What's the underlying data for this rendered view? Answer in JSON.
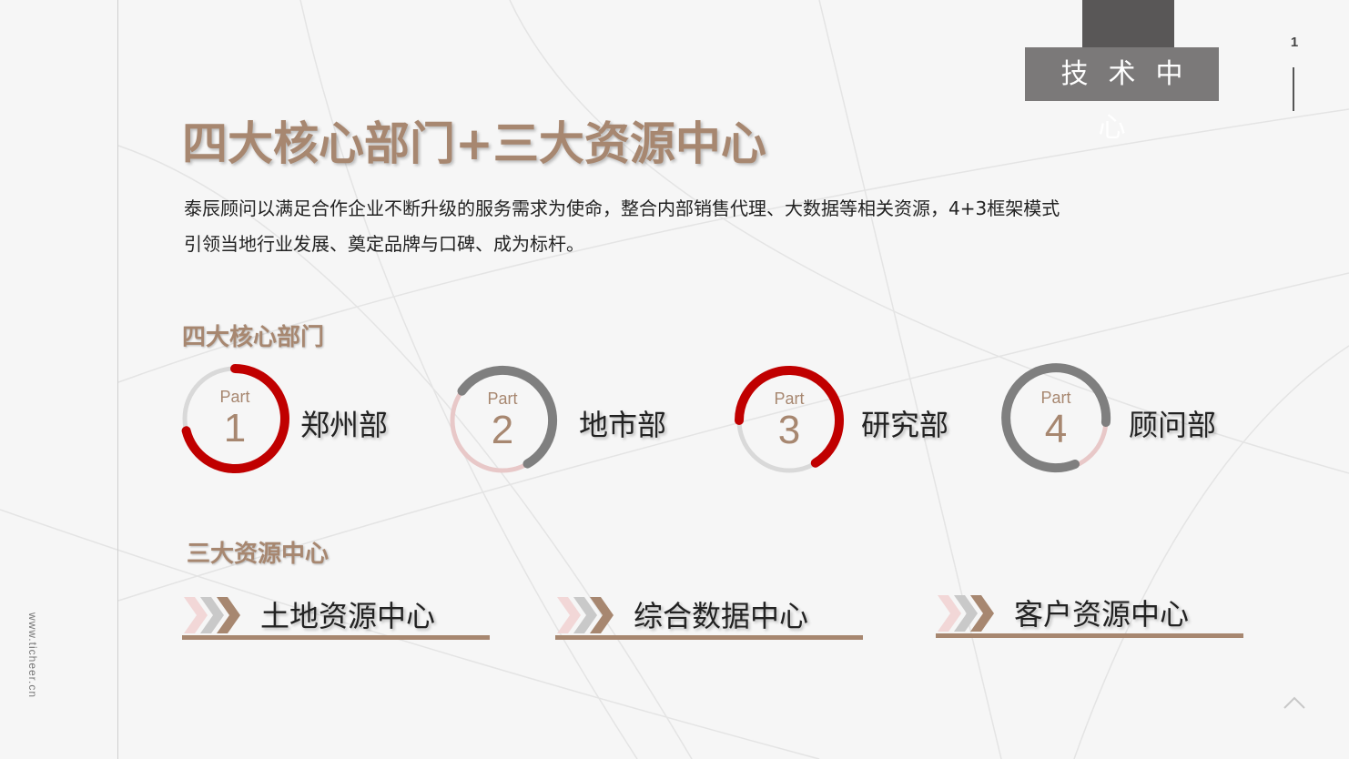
{
  "header": {
    "tag": "技术中心",
    "page_number": "1",
    "side_text": "www.ticheer.cn"
  },
  "main": {
    "title": "四大核心部门+三大资源中心",
    "intro_line1": "泰辰顾问以满足合作企业不断升级的服务需求为使命，整合内部销售代理、大数据等相关资源，4+3框架模式",
    "intro_line2": "引领当地行业发展、奠定品牌与口碑、成为标杆。"
  },
  "departments": {
    "heading": "四大核心部门",
    "items": [
      {
        "part_word": "Part",
        "number": "1",
        "name": "郑州部"
      },
      {
        "part_word": "Part",
        "number": "2",
        "name": "地市部"
      },
      {
        "part_word": "Part",
        "number": "3",
        "name": "研究部"
      },
      {
        "part_word": "Part",
        "number": "4",
        "name": "顾问部"
      }
    ]
  },
  "resources": {
    "heading": "三大资源中心",
    "items": [
      {
        "name": "土地资源中心"
      },
      {
        "name": "综合数据中心"
      },
      {
        "name": "客户资源中心"
      }
    ]
  },
  "colors": {
    "accent": "#a78770",
    "red": "#c00000",
    "gray": "#7f7f7f",
    "light_gray": "#d9d9d9",
    "pink": "#e8c8c8",
    "tag_dark": "#595757",
    "tag": "#7b7979"
  },
  "icons": {
    "chevrons": "triple-chevron-right-icon",
    "scroll_up": "chevron-up-icon"
  }
}
